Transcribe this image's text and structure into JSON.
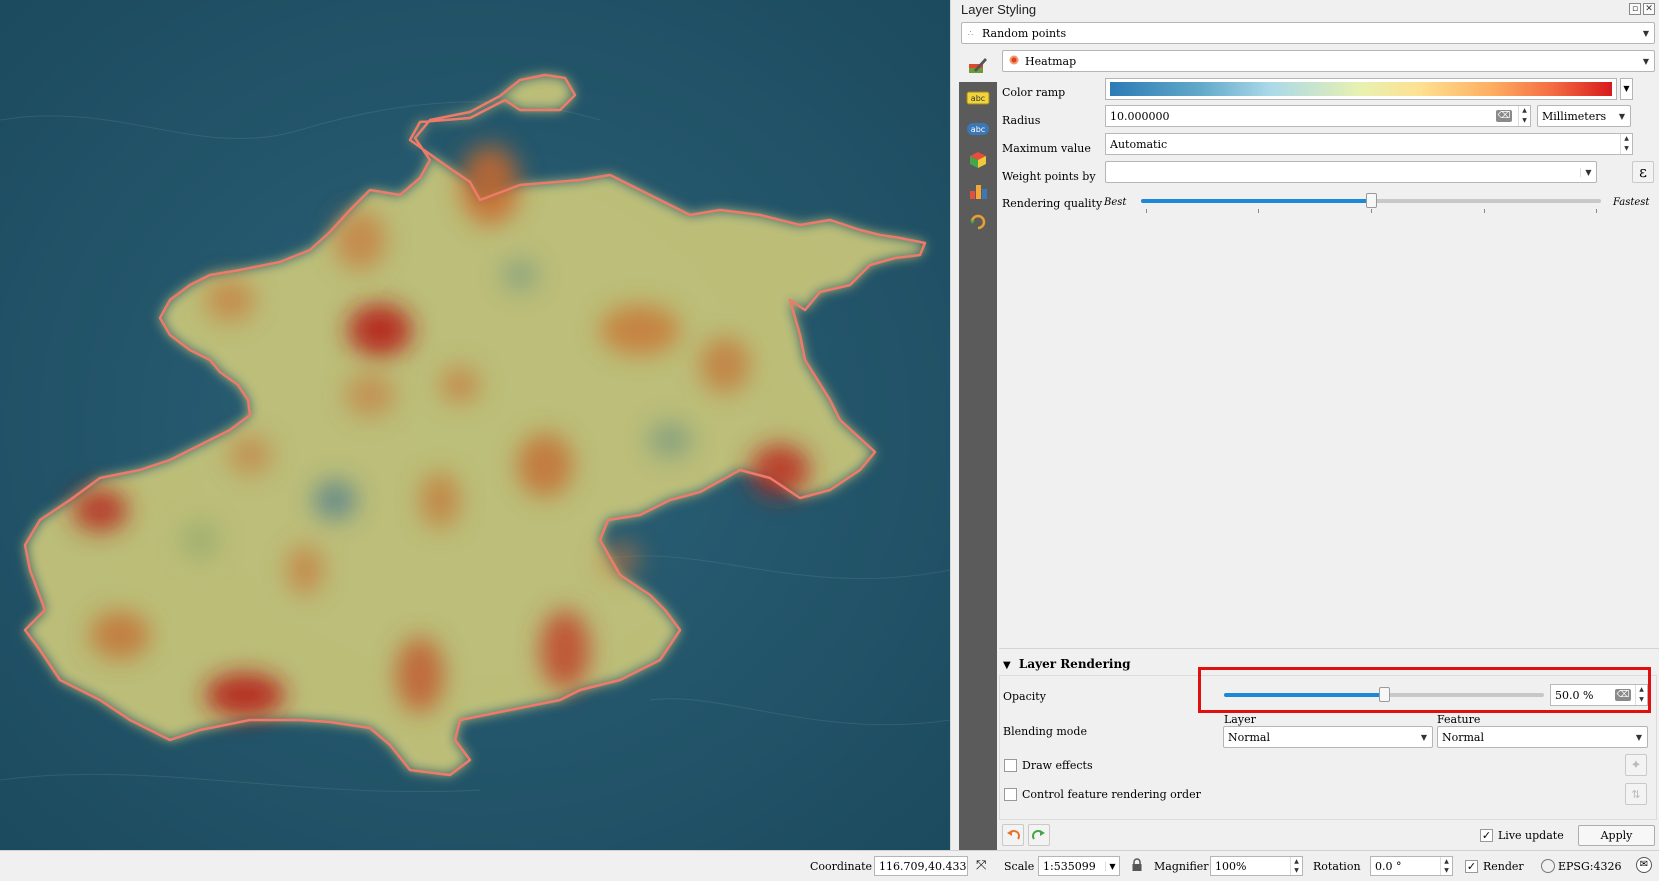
{
  "panel": {
    "title": "Layer Styling",
    "layer_select": "Random points",
    "renderer": "Heatmap",
    "props": {
      "color_ramp_label": "Color ramp",
      "radius_label": "Radius",
      "radius_value": "10.000000",
      "radius_unit": "Millimeters",
      "max_label": "Maximum value",
      "max_value": "Automatic",
      "weight_label": "Weight points by",
      "weight_value": "",
      "quality_label": "Rendering quality",
      "quality_best": "Best",
      "quality_fastest": "Fastest",
      "quality_level": 0.5
    },
    "rendering": {
      "header": "Layer Rendering",
      "opacity_label": "Opacity",
      "opacity_value": "50.0 %",
      "opacity_fraction": 0.5,
      "blending_label": "Blending mode",
      "layer_label": "Layer",
      "feature_label": "Feature",
      "layer_blend": "Normal",
      "feature_blend": "Normal",
      "draw_effects": "Draw effects",
      "control_order": "Control feature rendering order"
    },
    "footer": {
      "live_update": "Live update",
      "live_update_checked": true,
      "apply": "Apply"
    }
  },
  "statusbar": {
    "coordinate_label": "Coordinate",
    "coordinate_value": "116.709,40.433",
    "scale_label": "Scale",
    "scale_value": "1:535099",
    "magnifier_label": "Magnifier",
    "magnifier_value": "100%",
    "rotation_label": "Rotation",
    "rotation_value": "0.0 °",
    "render_label": "Render",
    "render_checked": true,
    "crs": "EPSG:4326"
  },
  "colors": {
    "highlight": "#e01010",
    "slider": "#1e88d8",
    "boundary": "#f07a6a"
  }
}
